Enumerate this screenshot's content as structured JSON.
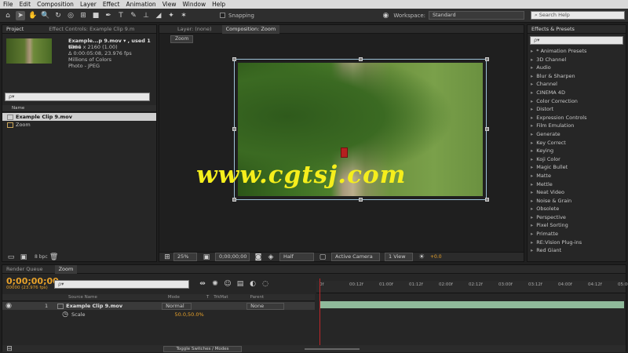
{
  "menu": [
    "File",
    "Edit",
    "Composition",
    "Layer",
    "Effect",
    "Animation",
    "View",
    "Window",
    "Help"
  ],
  "toolbar": {
    "snapping_label": "Snapping",
    "workspace_label": "Workspace:",
    "workspace_value": "Standard",
    "search_help_placeholder": "Search Help"
  },
  "project": {
    "tabs": [
      "Project",
      "Effect Controls: Example Clip 9.m"
    ],
    "file_name": "Example...p 9.mov ▾ , used 1 time",
    "file_dims": "4096 x 2160 (1.00)",
    "file_duration": "Δ 0:00:05:08, 23.976 fps",
    "file_colors": "Millions of Colors",
    "file_codec": "Photo - JPEG",
    "search_placeholder": "ρ▾",
    "name_header": "Name",
    "items": [
      {
        "name": "Example Clip 9.mov",
        "selected": true
      },
      {
        "name": "Zoom",
        "selected": false
      }
    ],
    "bpc": "8 bpc"
  },
  "comp": {
    "layer_tab": "Layer: (none)",
    "comp_tab": "Composition: Zoom",
    "crumb": "Zoom",
    "zoom": "25%",
    "timecode": "0;00;00;00",
    "resolution": "Half",
    "camera": "Active Camera",
    "view": "1 View",
    "exposure": "+0.0"
  },
  "watermark": "www.cgtsj.com",
  "effects": {
    "title": "Effects & Presets",
    "search_placeholder": "ρ▾",
    "items": [
      "* Animation Presets",
      "3D Channel",
      "Audio",
      "Blur & Sharpen",
      "Channel",
      "CINEMA 4D",
      "Color Correction",
      "Distort",
      "Expression Controls",
      "Film Emulation",
      "Generate",
      "Key Correct",
      "Keying",
      "Koji Color",
      "Magic Bullet",
      "Matte",
      "Mettle",
      "Neat Video",
      "Noise & Grain",
      "Obsolete",
      "Perspective",
      "Pixel Sorting",
      "Primatte",
      "RE:Vision Plug-ins",
      "Red Giant"
    ]
  },
  "timeline": {
    "tabs": [
      "Render Queue",
      "Zoom"
    ],
    "timecode": "0;00;00;00",
    "frame_info": "00000 (23.976 fps)",
    "search_placeholder": "ρ▾",
    "headers": {
      "source": "Source Name",
      "mode": "Mode",
      "t": "T",
      "trkmat": "TrkMat",
      "parent": "Parent"
    },
    "layer": {
      "index": "1",
      "name": "Example Clip 9.mov",
      "mode": "Normal",
      "parent": "None"
    },
    "scale_label": "Scale",
    "scale_value": "50.0,50.0%",
    "ruler_ticks": [
      "0f",
      "00:12f",
      "01:00f",
      "01:12f",
      "02:00f",
      "02:12f",
      "03:00f",
      "03:12f",
      "04:00f",
      "04:12f",
      "05:00f"
    ],
    "toggle_label": "Toggle Switches / Modes"
  },
  "colors": {
    "accent_orange": "#e8a22a",
    "watermark_yellow": "#f5ee1c",
    "playhead_red": "#c0262a",
    "track_green": "#8fb99a"
  }
}
